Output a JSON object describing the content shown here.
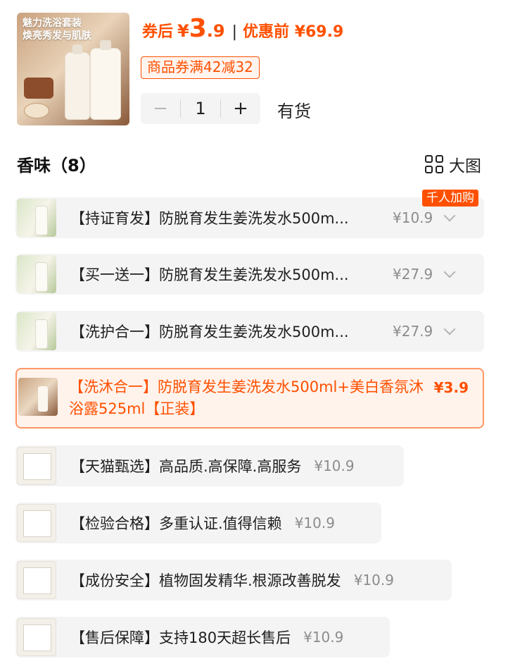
{
  "product": {
    "thumb_title_1": "魅力洗浴套装",
    "thumb_title_2": "焕亮秀发与肌肤",
    "price_label": "券后",
    "currency": "¥",
    "price_int": "3",
    "price_dec": ".9",
    "separator": "|",
    "orig_label": "优惠前 ¥69.9",
    "coupon": "商品券满42减32",
    "quantity": "1",
    "minus_label": "−",
    "plus_label": "+",
    "stock": "有货"
  },
  "section": {
    "title": "香味（8）",
    "view_label": "大图"
  },
  "hot_tag": "千人加购",
  "options": [
    {
      "label": "【持证育发】防脱育发生姜洗发水500m...",
      "price": "¥10.9"
    },
    {
      "label": "【买一送一】防脱育发生姜洗发水500m...",
      "price": "¥27.9"
    },
    {
      "label": "【洗护合一】防脱育发生姜洗发水500m...",
      "price": "¥27.9"
    },
    {
      "label": "【洗沐合一】防脱育发生姜洗发水500ml+美白香氛沐浴露525ml【正装】",
      "price": "¥3.9"
    },
    {
      "label": "【天猫甄选】高品质.高保障.高服务",
      "price": "¥10.9"
    },
    {
      "label": "【检验合格】多重认证.值得信赖",
      "price": "¥10.9"
    },
    {
      "label": "【成份安全】植物固发精华.根源改善脱发",
      "price": "¥10.9"
    },
    {
      "label": "【售后保障】支持180天超长售后",
      "price": "¥10.9"
    }
  ],
  "colors": {
    "accent": "#ff5000",
    "selected_bg": "#fff3ec",
    "option_bg": "#f4f4f4",
    "muted_price": "#8c8c8c"
  },
  "icons": [
    "chevron-down-icon",
    "grid-view-icon"
  ]
}
